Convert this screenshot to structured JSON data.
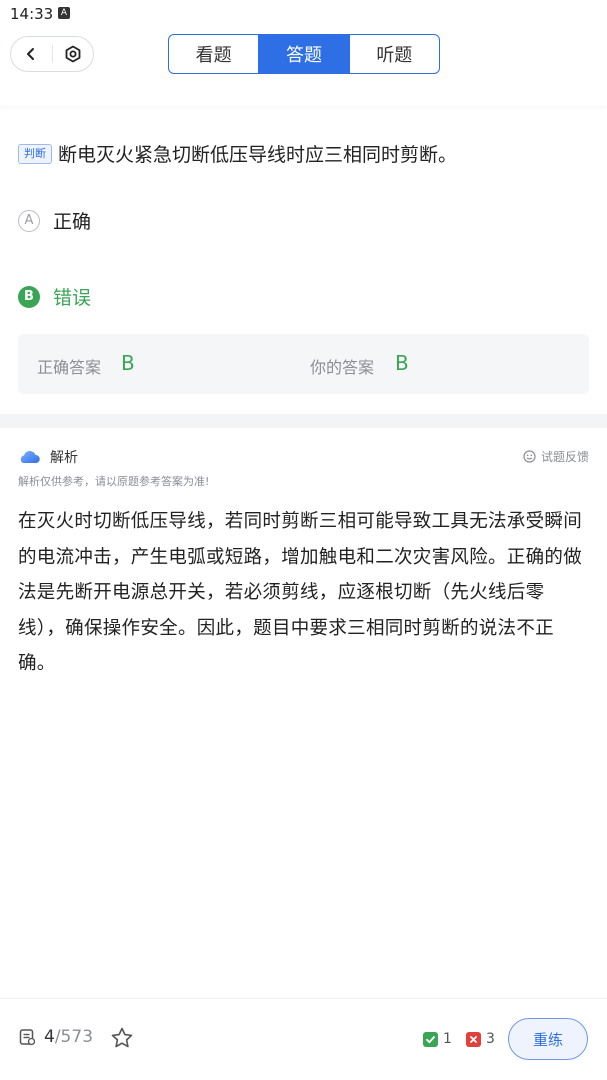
{
  "status": {
    "time": "14:33",
    "indicator": "A"
  },
  "header": {
    "tabs": [
      {
        "label": "看题",
        "active": false
      },
      {
        "label": "答题",
        "active": true
      },
      {
        "label": "听题",
        "active": false
      }
    ]
  },
  "question": {
    "type": "判断",
    "text": "断电灭火紧急切断低压导线时应三相同时剪断。",
    "options": [
      {
        "letter": "A",
        "text": "正确",
        "state": "normal"
      },
      {
        "letter": "B",
        "text": "错误",
        "state": "correct"
      }
    ]
  },
  "answer": {
    "correct_label": "正确答案",
    "correct_value": "B",
    "yours_label": "你的答案",
    "yours_value": "B"
  },
  "analysis": {
    "title": "解析",
    "feedback": "试题反馈",
    "disclaimer": "解析仅供参考，请以原题参考答案为准!",
    "body": "在灭火时切断低压导线，若同时剪断三相可能导致工具无法承受瞬间的电流冲击，产生电弧或短路，增加触电和二次灾害风险。正确的做法是先断开电源总开关，若必须剪线，应逐根切断（先火线后零线），确保操作安全。因此，题目中要求三相同时剪断的说法不正确。"
  },
  "footer": {
    "current": "4",
    "total": "/573",
    "correct_count": "1",
    "wrong_count": "3",
    "redo_label": "重练"
  },
  "colors": {
    "accent": "#2f6fe6",
    "correct": "#3aa655",
    "wrong": "#e0413a"
  },
  "icons": [
    "back-icon",
    "settings-icon",
    "cloud-icon",
    "feedback-icon",
    "exam-icon",
    "star-icon",
    "check-icon",
    "cross-icon"
  ]
}
